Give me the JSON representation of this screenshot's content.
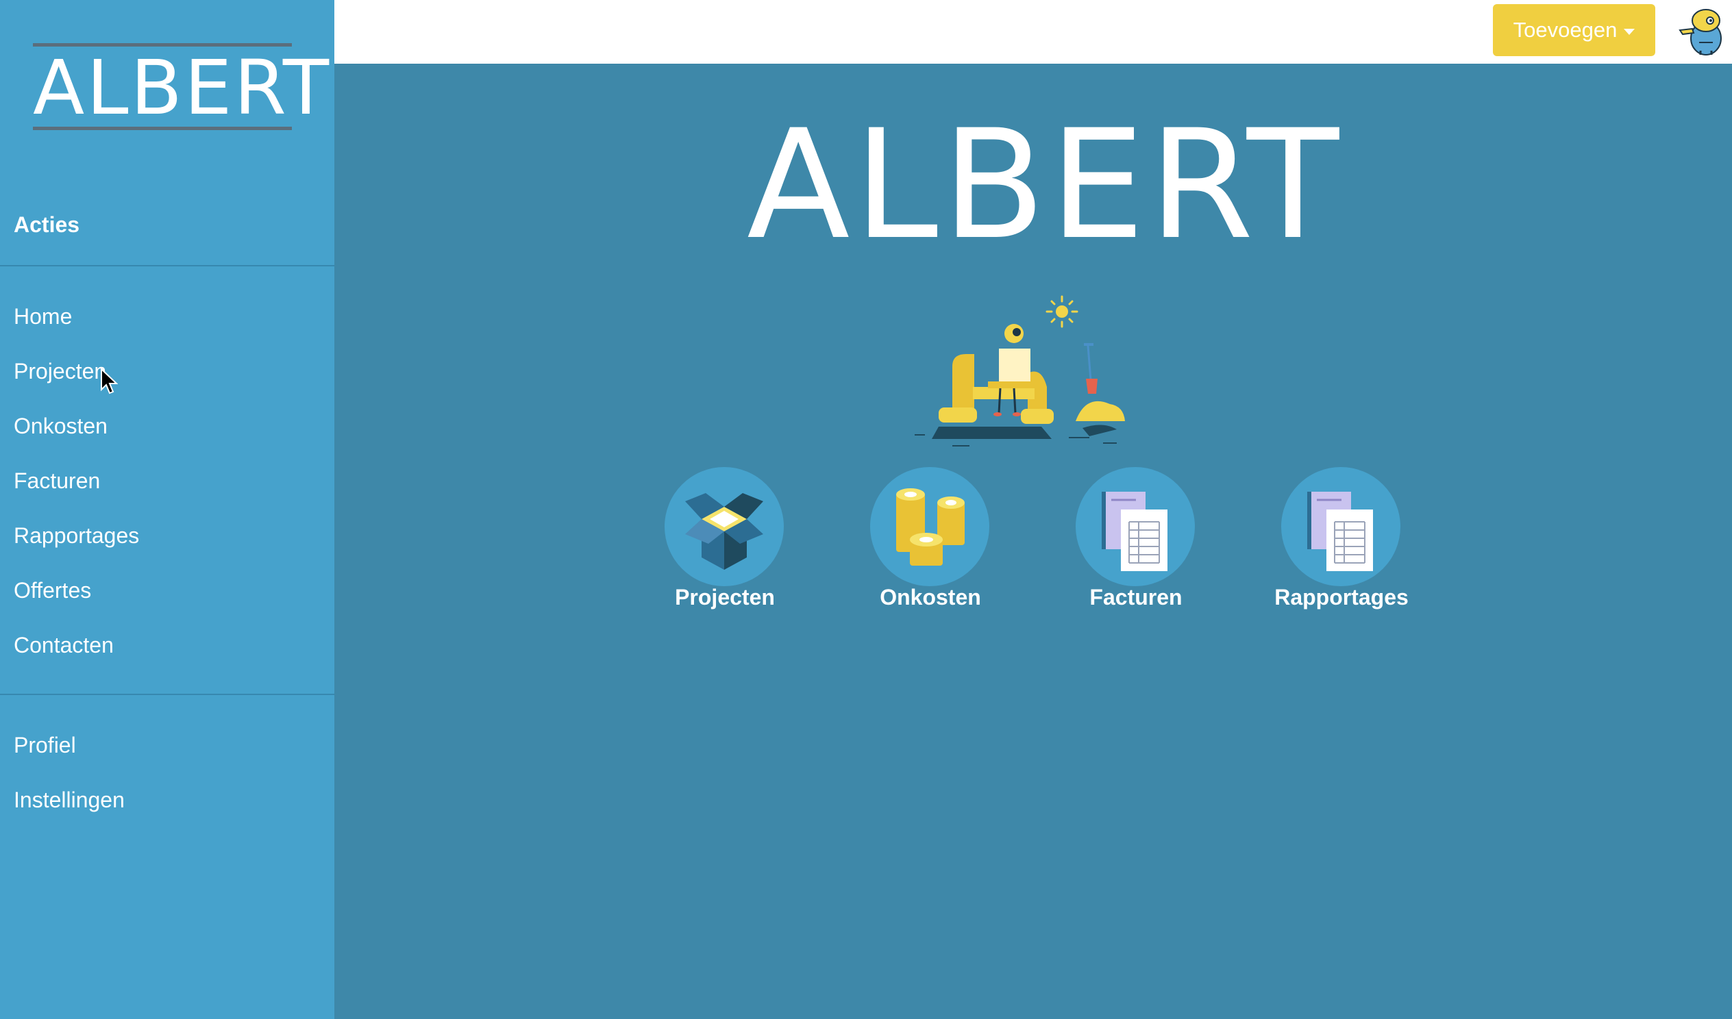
{
  "sidebar": {
    "logo_text": "ALBERT",
    "section_title": "Acties",
    "items": [
      {
        "label": "Home"
      },
      {
        "label": "Projecten"
      },
      {
        "label": "Onkosten"
      },
      {
        "label": "Facturen"
      },
      {
        "label": "Rapportages"
      },
      {
        "label": "Offertes"
      },
      {
        "label": "Contacten"
      }
    ],
    "account_items": [
      {
        "label": "Profiel"
      },
      {
        "label": "Instellingen"
      }
    ]
  },
  "topbar": {
    "add_button_label": "Toevoegen"
  },
  "main": {
    "hero_title": "ALBERT",
    "tiles": [
      {
        "label": "Projecten",
        "icon": "open-box-icon"
      },
      {
        "label": "Onkosten",
        "icon": "coins-icon"
      },
      {
        "label": "Facturen",
        "icon": "invoice-document-icon"
      },
      {
        "label": "Rapportages",
        "icon": "report-document-icon"
      }
    ]
  },
  "colors": {
    "sidebar": "#46a2cc",
    "main_background": "#3e88a9",
    "accent": "#f0cf40",
    "text": "#ffffff"
  }
}
